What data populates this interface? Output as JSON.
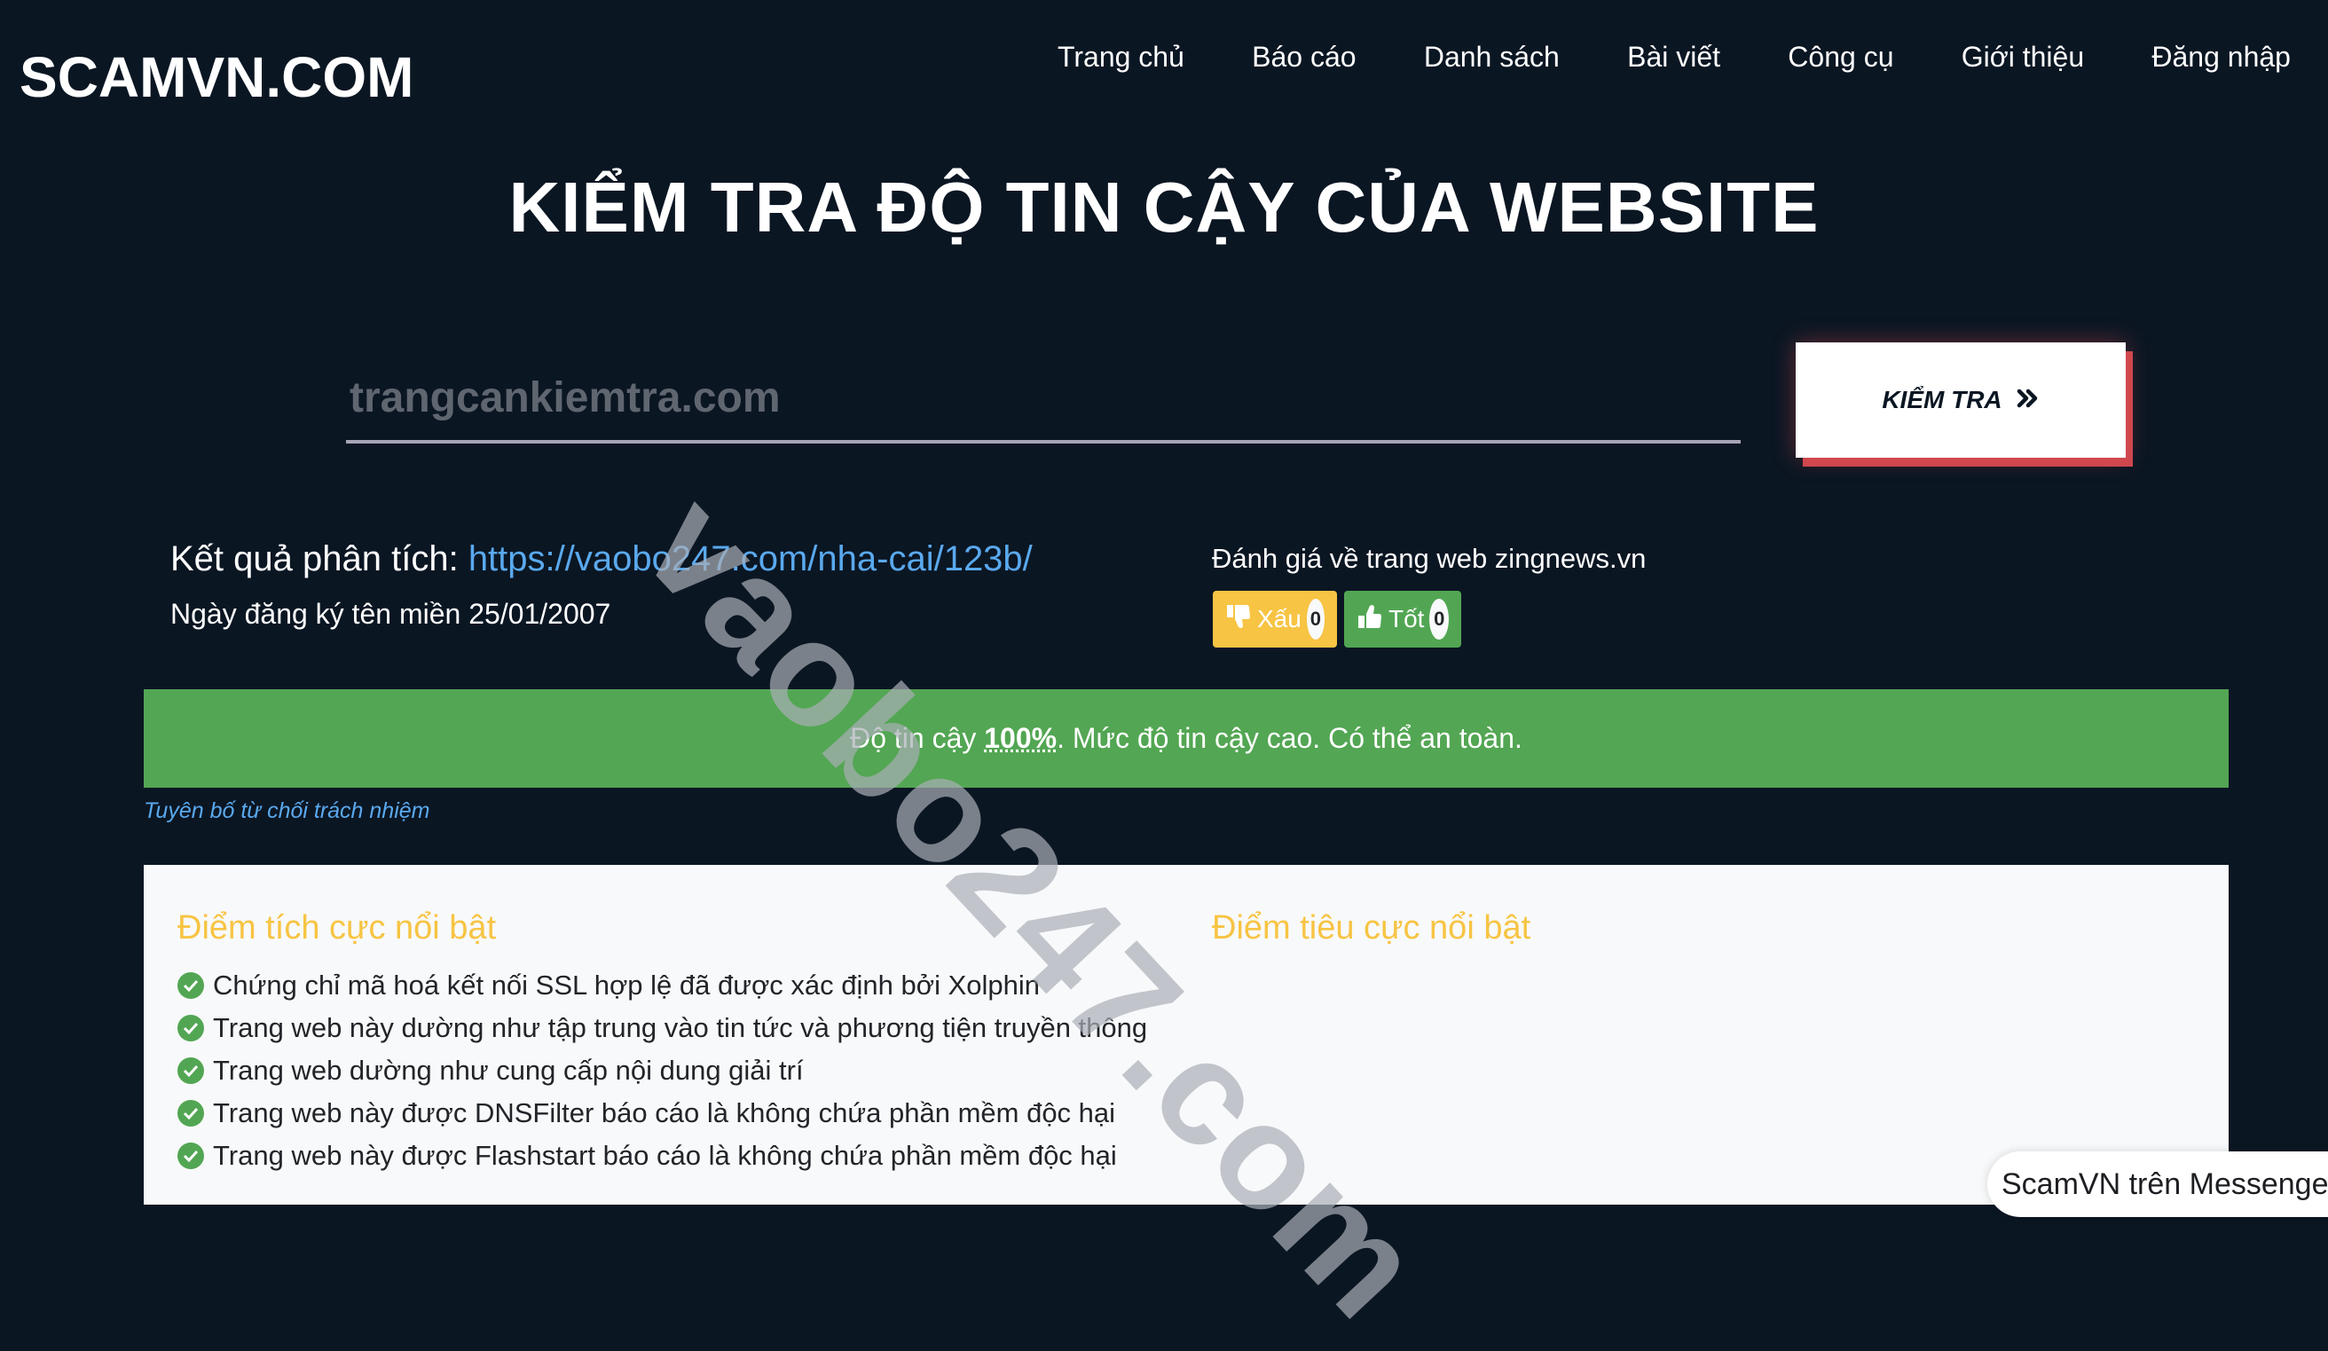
{
  "header": {
    "logo": "SCAMVN.COM",
    "nav": [
      "Trang chủ",
      "Báo cáo",
      "Danh sách",
      "Bài viết",
      "Công cụ",
      "Giới thiệu",
      "Đăng nhập"
    ]
  },
  "hero": {
    "title": "KIỂM TRA ĐỘ TIN CẬY CỦA WEBSITE",
    "search_placeholder": "trangcankiemtra.com",
    "search_value": "",
    "check_button": "KIỂM TRA",
    "check_button_icon": "double-chevron-right-icon"
  },
  "result": {
    "label": "Kết quả phân tích: ",
    "url": "https://vaobo247.com/nha-cai/123b/",
    "registration": "Ngày đăng ký tên miền 25/01/2007",
    "rating_title": "Đánh giá về trang web zingnews.vn",
    "bad_label": "Xấu",
    "bad_count": "0",
    "good_label": "Tốt",
    "good_count": "0"
  },
  "trust": {
    "prefix": "Độ tin cậy ",
    "percent": "100%",
    "suffix": ". Mức độ tin cậy cao. Có thể an toàn.",
    "color": "#53a653"
  },
  "disclaimer": "Tuyên bố từ chối trách nhiệm",
  "highlights": {
    "positive_title": "Điểm tích cực nổi bật",
    "negative_title": "Điểm tiêu cực nổi bật",
    "positive": [
      "Chứng chỉ mã hoá kết nối SSL hợp lệ đã được xác định bởi Xolphin",
      "Trang web này dường như tập trung vào tin tức và phương tiện truyền thông",
      "Trang web dường như cung cấp nội dung giải trí",
      "Trang web này được DNSFilter báo cáo là không chứa phần mềm độc hại",
      "Trang web này được Flashstart báo cáo là không chứa phần mềm độc hại"
    ]
  },
  "watermark": "vaobo247.com",
  "messenger": "ScamVN trên Messenger"
}
